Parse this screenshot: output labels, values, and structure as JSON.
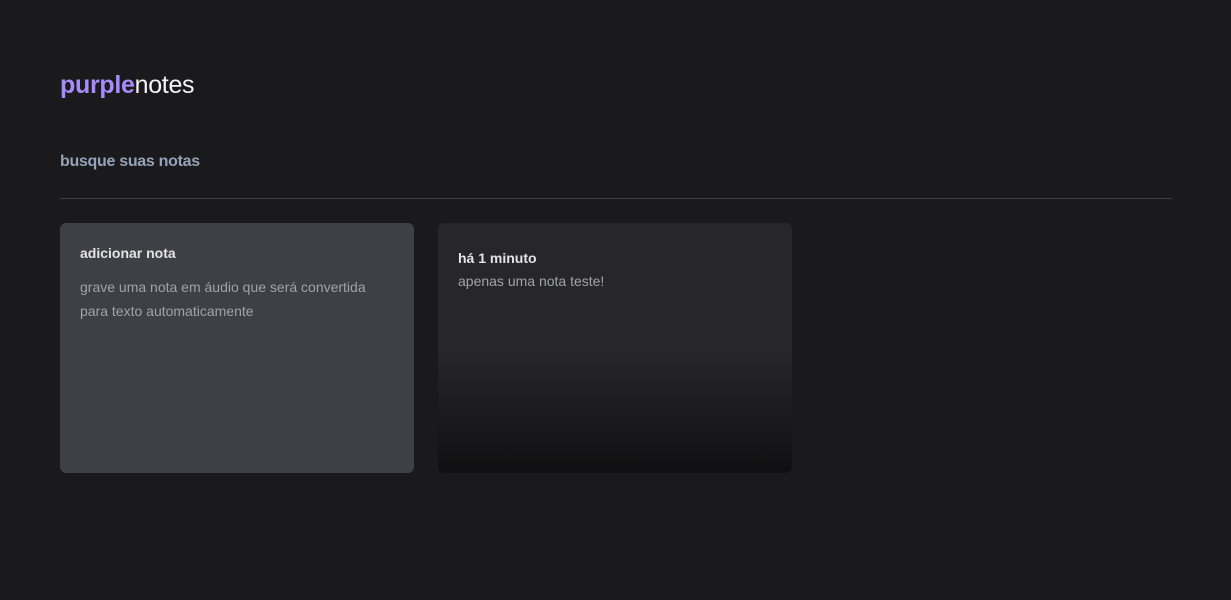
{
  "logo": {
    "brand_accent": "purple",
    "brand_rest": "notes",
    "accent_color": "#a78bfa"
  },
  "search": {
    "placeholder": "busque suas notas",
    "value": ""
  },
  "add_note_card": {
    "title": "adicionar nota",
    "description": "grave uma nota em áudio que será convertida para texto automaticamente"
  },
  "notes": [
    {
      "date": "há 1 minuto",
      "content": "apenas uma nota teste!"
    }
  ]
}
